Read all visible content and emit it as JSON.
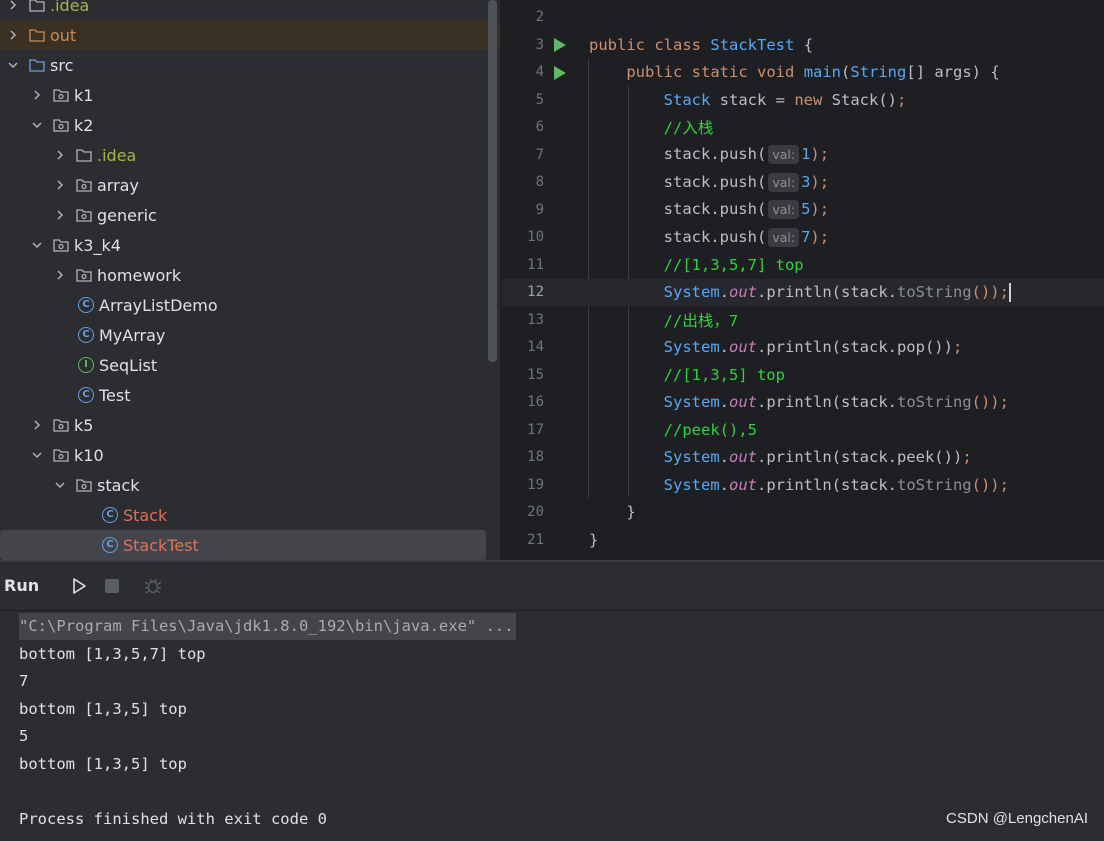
{
  "tree": {
    "items": [
      {
        "label": ".idea",
        "type": "folder"
      },
      {
        "label": "out",
        "type": "folder"
      },
      {
        "label": "src",
        "type": "folder"
      },
      {
        "label": "k1",
        "type": "package"
      },
      {
        "label": "k2",
        "type": "package"
      },
      {
        "label": ".idea",
        "type": "folder"
      },
      {
        "label": "array",
        "type": "package"
      },
      {
        "label": "generic",
        "type": "package"
      },
      {
        "label": "k3_k4",
        "type": "package"
      },
      {
        "label": "homework",
        "type": "package"
      },
      {
        "label": "ArrayListDemo",
        "type": "class",
        "icon": "C"
      },
      {
        "label": "MyArray",
        "type": "class",
        "icon": "C"
      },
      {
        "label": "SeqList",
        "type": "interface",
        "icon": "I"
      },
      {
        "label": "Test",
        "type": "class",
        "icon": "C"
      },
      {
        "label": "k5",
        "type": "package"
      },
      {
        "label": "k10",
        "type": "package"
      },
      {
        "label": "stack",
        "type": "package"
      },
      {
        "label": "Stack",
        "type": "class",
        "icon": "C"
      },
      {
        "label": "StackTest",
        "type": "class",
        "icon": "C",
        "selected": true
      }
    ]
  },
  "editor": {
    "current_line": "12",
    "lines": [
      {
        "n": "2"
      },
      {
        "n": "3",
        "parts": [
          "public",
          "class",
          "StackTest",
          "{"
        ]
      },
      {
        "n": "4",
        "parts": [
          "public",
          "static",
          "void",
          "main",
          "(",
          "String",
          "[] args) {"
        ]
      },
      {
        "n": "5",
        "parts": [
          "Stack",
          " stack = ",
          "new",
          " Stack()",
          ";"
        ]
      },
      {
        "n": "6",
        "comment": "//入栈"
      },
      {
        "n": "7",
        "call": "stack.push(",
        "hint": "val:",
        "arg": "1",
        "end": ");"
      },
      {
        "n": "8",
        "call": "stack.push(",
        "hint": "val:",
        "arg": "3",
        "end": ");"
      },
      {
        "n": "9",
        "call": "stack.push(",
        "hint": "val:",
        "arg": "5",
        "end": ");"
      },
      {
        "n": "10",
        "call": "stack.push(",
        "hint": "val:",
        "arg": "7",
        "end": ");"
      },
      {
        "n": "11",
        "comment": "//[1,3,5,7] top"
      },
      {
        "n": "12",
        "sys": "System",
        "out": "out",
        "pre": ".println(stack.",
        "m": "toString",
        "post": "());"
      },
      {
        "n": "13",
        "comment": "//出栈，7"
      },
      {
        "n": "14",
        "sys": "System",
        "out": "out",
        "pre": ".println(stack.pop())",
        "post": ";"
      },
      {
        "n": "15",
        "comment": "//[1,3,5] top"
      },
      {
        "n": "16",
        "sys": "System",
        "out": "out",
        "pre": ".println(stack.",
        "m": "toString",
        "post": "());"
      },
      {
        "n": "17",
        "comment": "//peek(),5"
      },
      {
        "n": "18",
        "sys": "System",
        "out": "out",
        "pre": ".println(stack.peek())",
        "post": ";"
      },
      {
        "n": "19",
        "sys": "System",
        "out": "out",
        "pre": ".println(stack.",
        "m": "toString",
        "post": "());"
      },
      {
        "n": "20",
        "brace": "}"
      },
      {
        "n": "21",
        "brace": "}"
      }
    ]
  },
  "run": {
    "title": "Run",
    "output": [
      "\"C:\\Program Files\\Java\\jdk1.8.0_192\\bin\\java.exe\" ...",
      "bottom [1,3,5,7] top",
      "7",
      "bottom [1,3,5] top",
      "5",
      "bottom [1,3,5] top",
      "",
      "Process finished with exit code 0"
    ]
  },
  "watermark": "CSDN @LengchenAI",
  "colors": {
    "accent_blue": "#56a8f5",
    "keyword": "#cf8e6d",
    "comment": "#2dd43c",
    "run_green": "#5fb865",
    "class_red": "#e0705b"
  }
}
